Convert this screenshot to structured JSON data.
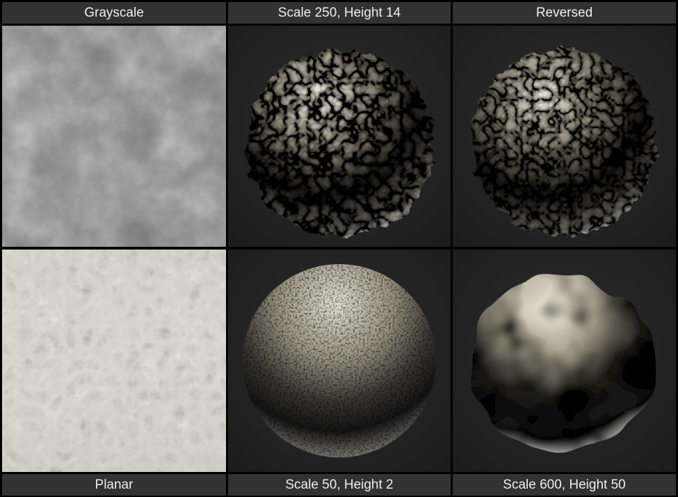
{
  "labels": {
    "top": [
      "Grayscale",
      "Scale 250, Height 14",
      "Reversed"
    ],
    "bottom": [
      "Planar",
      "Scale 50, Height 2",
      "Scale 600, Height 50"
    ]
  },
  "colors": {
    "label_background": "#323232",
    "label_text": "#eeeeee",
    "viewport_background": "#262626",
    "grid_border": "#000000"
  },
  "tiles": [
    {
      "id": "grayscale",
      "content": "grayscale-noise-texture"
    },
    {
      "id": "scale250-height14",
      "content": "displaced-sphere-render"
    },
    {
      "id": "reversed",
      "content": "displaced-sphere-render"
    },
    {
      "id": "planar",
      "content": "planar-displacement-render"
    },
    {
      "id": "scale50-height2",
      "content": "fine-bump-sphere-render"
    },
    {
      "id": "scale600-height50",
      "content": "heavy-displaced-blob-render"
    }
  ]
}
